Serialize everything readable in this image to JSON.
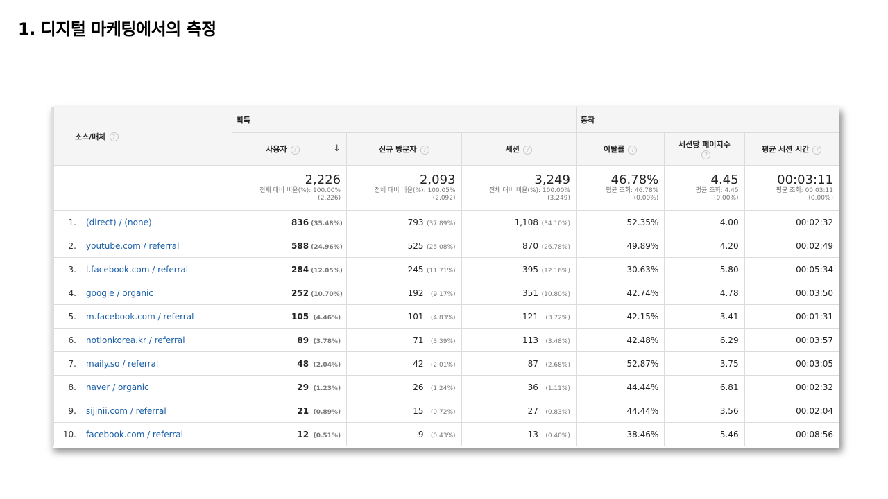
{
  "slide_title": "1. 디지털 마케팅에서의 측정",
  "groups": {
    "acquisition": "획득",
    "behavior": "동작"
  },
  "dimension_header": "소스/매체",
  "columns": {
    "users": "사용자",
    "new_users": "신규 방문자",
    "sessions": "세션",
    "bounce_rate": "이탈률",
    "pages_per_session": "세션당 페이지수",
    "avg_session_duration": "평균 세션 시간"
  },
  "help_glyph": "?",
  "sort_glyph": "↓",
  "totals": {
    "users": {
      "value": "2,226",
      "line1": "전체 대비 비율(%): 100.00%",
      "line2": "(2,226)"
    },
    "new_users": {
      "value": "2,093",
      "line1": "전체 대비 비율(%): 100.05%",
      "line2": "(2,092)"
    },
    "sessions": {
      "value": "3,249",
      "line1": "전체 대비 비율(%): 100.00%",
      "line2": "(3,249)"
    },
    "bounce_rate": {
      "value": "46.78%",
      "line1": "평균 조회: 46.78%",
      "line2": "(0.00%)"
    },
    "pages_per_session": {
      "value": "4.45",
      "line1": "평균 조회: 4.45",
      "line2": "(0.00%)"
    },
    "avg_session_duration": {
      "value": "00:03:11",
      "line1": "평균 조회: 00:03:11",
      "line2": "(0.00%)"
    }
  },
  "rows": [
    {
      "index": "1.",
      "source": "(direct) / (none)",
      "users": "836",
      "users_pct": "(35.48%)",
      "new_users": "793",
      "new_users_pct": "(37.89%)",
      "sessions": "1,108",
      "sessions_pct": "(34.10%)",
      "bounce": "52.35%",
      "pps": "4.00",
      "duration": "00:02:32"
    },
    {
      "index": "2.",
      "source": "youtube.com / referral",
      "users": "588",
      "users_pct": "(24.96%)",
      "new_users": "525",
      "new_users_pct": "(25.08%)",
      "sessions": "870",
      "sessions_pct": "(26.78%)",
      "bounce": "49.89%",
      "pps": "4.20",
      "duration": "00:02:49"
    },
    {
      "index": "3.",
      "source": "l.facebook.com / referral",
      "users": "284",
      "users_pct": "(12.05%)",
      "new_users": "245",
      "new_users_pct": "(11.71%)",
      "sessions": "395",
      "sessions_pct": "(12.16%)",
      "bounce": "30.63%",
      "pps": "5.80",
      "duration": "00:05:34"
    },
    {
      "index": "4.",
      "source": "google / organic",
      "users": "252",
      "users_pct": "(10.70%)",
      "new_users": "192",
      "new_users_pct": "(9.17%)",
      "sessions": "351",
      "sessions_pct": "(10.80%)",
      "bounce": "42.74%",
      "pps": "4.78",
      "duration": "00:03:50"
    },
    {
      "index": "5.",
      "source": "m.facebook.com / referral",
      "users": "105",
      "users_pct": "(4.46%)",
      "new_users": "101",
      "new_users_pct": "(4.83%)",
      "sessions": "121",
      "sessions_pct": "(3.72%)",
      "bounce": "42.15%",
      "pps": "3.41",
      "duration": "00:01:31"
    },
    {
      "index": "6.",
      "source": "notionkorea.kr / referral",
      "users": "89",
      "users_pct": "(3.78%)",
      "new_users": "71",
      "new_users_pct": "(3.39%)",
      "sessions": "113",
      "sessions_pct": "(3.48%)",
      "bounce": "42.48%",
      "pps": "6.29",
      "duration": "00:03:57"
    },
    {
      "index": "7.",
      "source": "maily.so / referral",
      "users": "48",
      "users_pct": "(2.04%)",
      "new_users": "42",
      "new_users_pct": "(2.01%)",
      "sessions": "87",
      "sessions_pct": "(2.68%)",
      "bounce": "52.87%",
      "pps": "3.75",
      "duration": "00:03:05"
    },
    {
      "index": "8.",
      "source": "naver / organic",
      "users": "29",
      "users_pct": "(1.23%)",
      "new_users": "26",
      "new_users_pct": "(1.24%)",
      "sessions": "36",
      "sessions_pct": "(1.11%)",
      "bounce": "44.44%",
      "pps": "6.81",
      "duration": "00:02:32"
    },
    {
      "index": "9.",
      "source": "sijinii.com / referral",
      "users": "21",
      "users_pct": "(0.89%)",
      "new_users": "15",
      "new_users_pct": "(0.72%)",
      "sessions": "27",
      "sessions_pct": "(0.83%)",
      "bounce": "44.44%",
      "pps": "3.56",
      "duration": "00:02:04"
    },
    {
      "index": "10.",
      "source": "facebook.com / referral",
      "users": "12",
      "users_pct": "(0.51%)",
      "new_users": "9",
      "new_users_pct": "(0.43%)",
      "sessions": "13",
      "sessions_pct": "(0.40%)",
      "bounce": "38.46%",
      "pps": "5.46",
      "duration": "00:08:56"
    }
  ]
}
